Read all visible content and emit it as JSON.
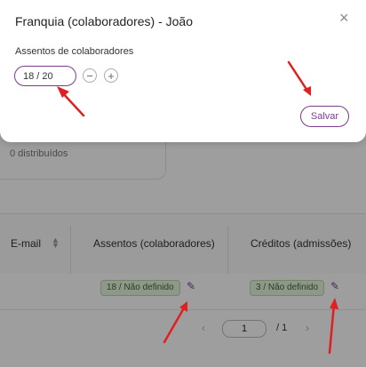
{
  "modal": {
    "title": "Franquia (colaboradores) - João",
    "close_label": "×",
    "field_label": "Assentos de colaboradores",
    "seats_value": "18 / 20",
    "decrement_label": "−",
    "increment_label": "+",
    "save_label": "Salvar"
  },
  "background": {
    "card_subtitle": "0 distribuídos",
    "table": {
      "headers": [
        "E-mail",
        "Assentos (colaboradores)",
        "Créditos (admissões)"
      ],
      "rows": [
        {
          "seats": "18 / Não definido",
          "credits": "3 / Não definido"
        }
      ]
    },
    "pagination": {
      "current": "1",
      "total": "/ 1",
      "prev": "‹",
      "next": "›"
    }
  },
  "colors": {
    "accent": "#7b3c8f",
    "arrow": "#e02020",
    "badge_bg": "#e7f3df"
  }
}
